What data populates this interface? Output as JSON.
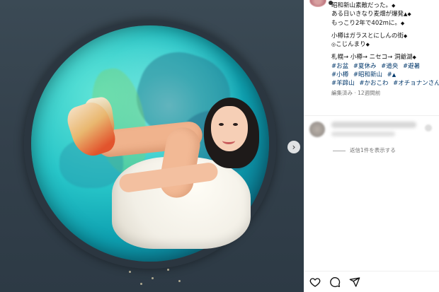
{
  "media": {
    "next_icon": "chevron-right-icon",
    "next_glyph": "›"
  },
  "post": {
    "caption_lines": [
      "昭和新山素敵だった。",
      "ある日いきなり麦畑が爆発",
      "もっこり2年で402mに。",
      "",
      "小樽はガラスとにしんの街",
      "こじんまり",
      "",
      "札幌→ 小樽→ ニセコ→ 洞爺湖"
    ],
    "hashtags_row1": [
      "#お盆",
      "#夏休み",
      "#道央",
      "#避暑"
    ],
    "hashtags_row2": [
      "#小樽",
      "#昭和新山",
      "#"
    ],
    "hashtags_row3": [
      "#羊蹄山",
      "#かおこわ",
      "#オチョナンさん"
    ],
    "edited_meta": "編集済み · 12週間前"
  },
  "replies": {
    "view_replies_label": "返信1件を表示する"
  },
  "actions": {
    "icons": [
      "heart-icon",
      "comment-icon",
      "share-icon"
    ]
  },
  "colors": {
    "hashtag": "#00376b",
    "meta": "#737373",
    "text": "#111111"
  }
}
